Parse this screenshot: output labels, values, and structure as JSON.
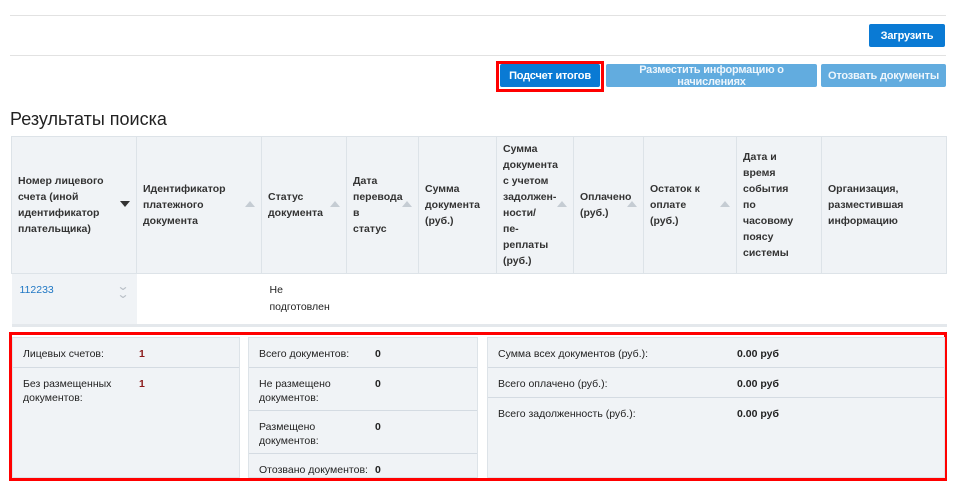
{
  "toolbar": {
    "upload_label": "Загрузить",
    "calc_totals_label": "Подсчет итогов",
    "place_info_label": "Разместить информацию о начислениях",
    "revoke_label": "Отозвать документы"
  },
  "results": {
    "title": "Результаты поиска",
    "columns": [
      "Номер лицевого счета (иной идентификатор плательщика)",
      "Идентификатор платежного документа",
      "Статус документа",
      "Дата перевода в статус",
      "Сумма документа (руб.)",
      "Сумма документа с учетом задолжен-ности/пе-реплаты (руб.)",
      "Оплачено (руб.)",
      "Остаток к оплате (руб.)",
      "Дата и время события по часовому поясу системы",
      "Организация, разместившая информацию"
    ],
    "rows": [
      {
        "account": "112233",
        "payment_id": "",
        "status": "Не подготовлен"
      }
    ]
  },
  "summary": {
    "accounts": {
      "label": "Лицевых счетов:",
      "value": "1"
    },
    "no_docs": {
      "label": "Без размещенных документов:",
      "value": "1"
    },
    "total_docs": {
      "label": "Всего документов:",
      "value": "0"
    },
    "not_placed": {
      "label": "Не размещено документов:",
      "value": "0"
    },
    "placed": {
      "label": "Размещено документов:",
      "value": "0"
    },
    "revoked": {
      "label": "Отозвано документов:",
      "value": "0"
    },
    "sum_all": {
      "label": "Сумма всех документов (руб.):",
      "value": "0.00 руб"
    },
    "paid": {
      "label": "Всего оплачено (руб.):",
      "value": "0.00 руб"
    },
    "debt": {
      "label": "Всего задолженность (руб.):",
      "value": "0.00 руб"
    }
  }
}
